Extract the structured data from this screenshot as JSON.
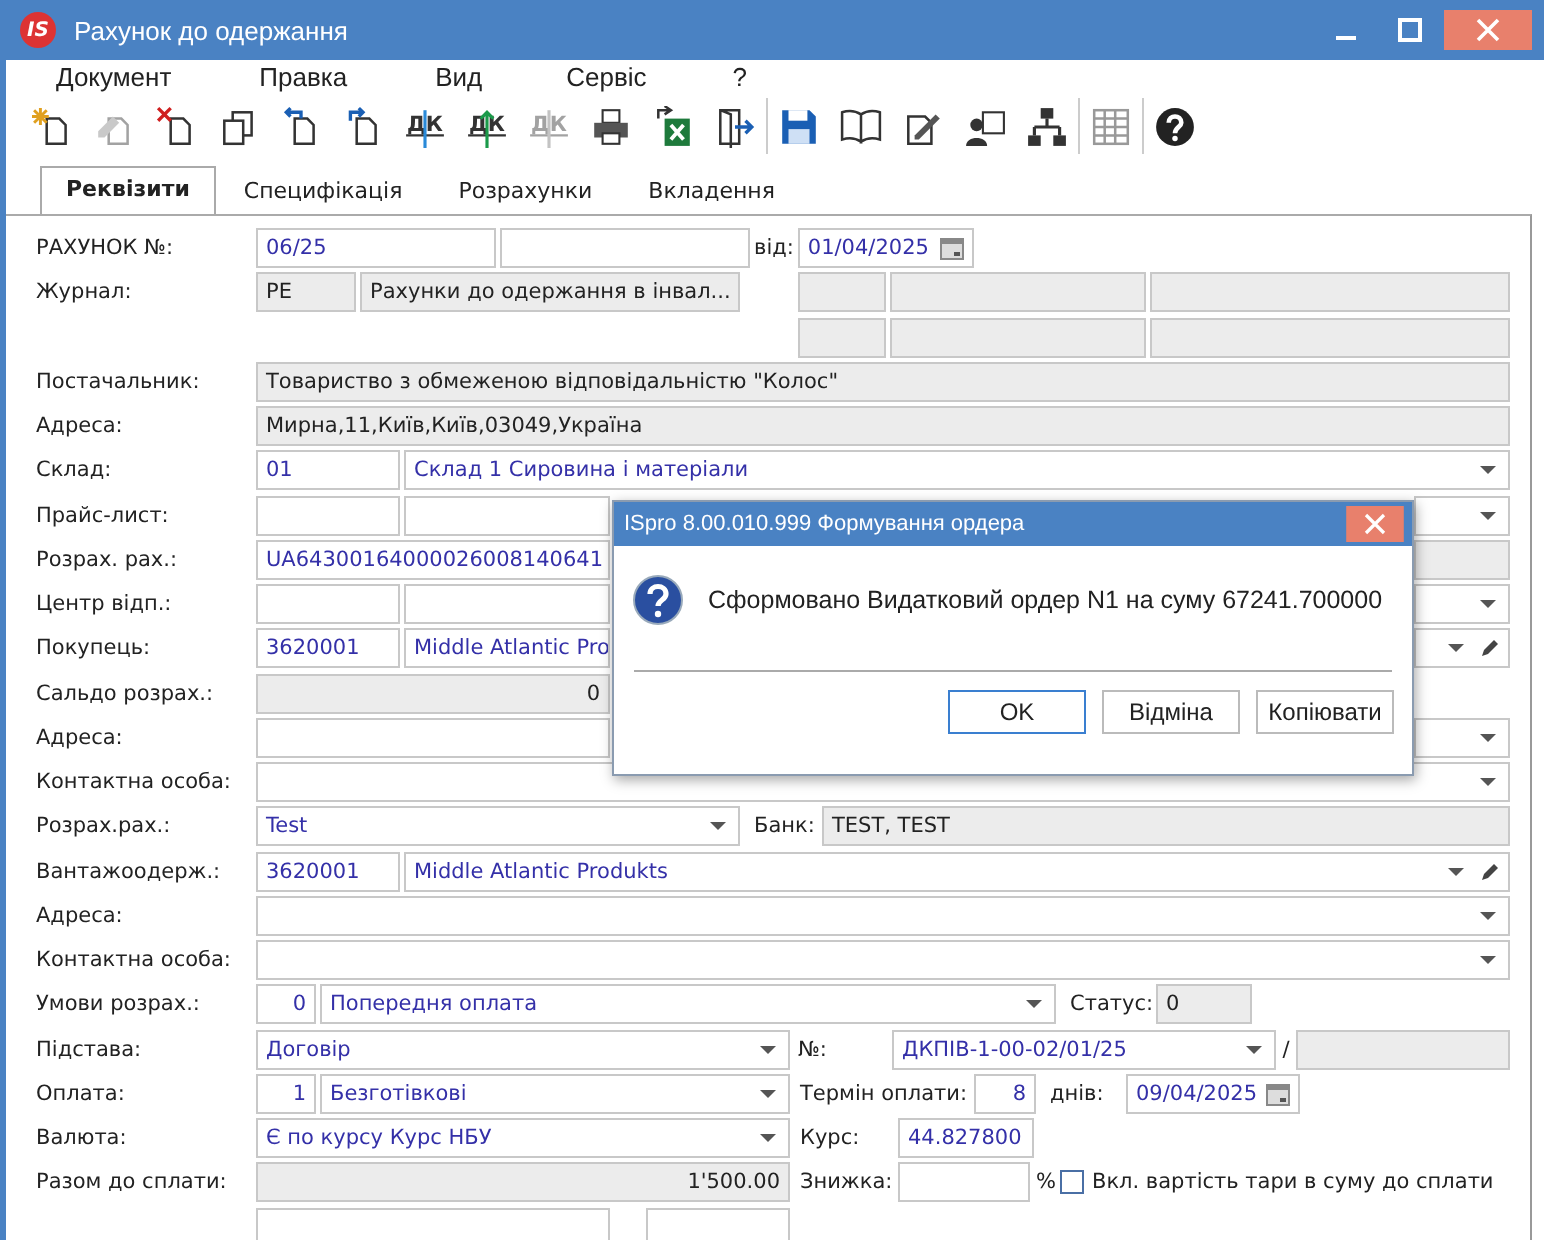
{
  "window": {
    "logo": "IS",
    "title": "Рахунок до одержання"
  },
  "menu": [
    "Документ",
    "Правка",
    "Вид",
    "Сервіс",
    "?"
  ],
  "toolbar": [
    [
      {
        "kind": "new",
        "disabled": false
      },
      {
        "kind": "edit",
        "disabled": true
      },
      {
        "kind": "delete",
        "disabled": false
      },
      {
        "kind": "copy",
        "disabled": false
      },
      {
        "kind": "prev",
        "disabled": false
      },
      {
        "kind": "next",
        "disabled": false
      },
      {
        "kind": "dk-down",
        "glyph": "ДК",
        "disabled": false
      },
      {
        "kind": "dk-up",
        "glyph": "ДК",
        "disabled": false
      },
      {
        "kind": "dk-down",
        "glyph": "ДК",
        "disabled": true
      },
      {
        "kind": "print",
        "disabled": false
      },
      {
        "kind": "excel",
        "disabled": false
      },
      {
        "kind": "exit",
        "disabled": false
      }
    ],
    [
      {
        "kind": "save",
        "disabled": false
      },
      {
        "kind": "book",
        "disabled": false
      },
      {
        "kind": "attach",
        "disabled": false
      },
      {
        "kind": "user",
        "disabled": false
      },
      {
        "kind": "tree",
        "disabled": false
      }
    ],
    [
      {
        "kind": "grid",
        "disabled": false
      }
    ],
    [
      {
        "kind": "help",
        "disabled": false
      }
    ]
  ],
  "tabs": [
    {
      "label": "Реквізити",
      "selected": true
    },
    {
      "label": "Специфікація",
      "selected": false
    },
    {
      "label": "Розрахунки",
      "selected": false
    },
    {
      "label": "Вкладення",
      "selected": false
    }
  ],
  "form": {
    "invoice": {
      "label": "РАХУНОК №:",
      "number": {
        "value": "06/25",
        "readonly": false
      },
      "extra": {
        "readonly": false
      },
      "date_label": "від:",
      "date": {
        "value": "01/04/2025",
        "readonly": false
      }
    },
    "journal": {
      "label": "Журнал:",
      "code": {
        "value": "РЕ",
        "readonly": true
      },
      "name": {
        "value": "Рахунки до одержання в інвал...",
        "readonly": true
      }
    },
    "side_grid": [
      [
        {
          "readonly": true
        },
        {
          "readonly": true
        },
        {
          "readonly": true
        }
      ],
      [
        {
          "readonly": true
        },
        {
          "readonly": true
        },
        {
          "readonly": true
        }
      ]
    ],
    "supplier": {
      "label": "Постачальник:",
      "field": {
        "value": "Товариство з обмеженою відповідальністю \"Колос\"",
        "readonly": true
      }
    },
    "supplier_address": {
      "label": "Адреса:",
      "field": {
        "value": "Мирна,11,Київ,Київ,03049,Україна",
        "readonly": true
      }
    },
    "warehouse": {
      "label": "Склад:",
      "code": {
        "value": "01",
        "readonly": false
      },
      "name": {
        "value": "Склад 1 Сировина і матеріали",
        "readonly": false
      }
    },
    "price_list": {
      "label": "Прайс-лист:",
      "code": {
        "readonly": false
      },
      "name": {
        "readonly": false
      }
    },
    "account": {
      "label": "Розрах. рах.:",
      "field": {
        "value": "UA64300164000026008140641",
        "readonly": false
      },
      "bank": {
        "readonly": true
      }
    },
    "center": {
      "label": "Центр відп.:",
      "code": {
        "readonly": false
      },
      "name": {
        "readonly": false
      }
    },
    "buyer": {
      "label": "Покупець:",
      "code": {
        "value": "3620001",
        "readonly": false
      },
      "name": {
        "value": "Middle Atlantic Pro",
        "readonly": false
      }
    },
    "balance": {
      "label": "Сальдо розрах.:",
      "field": {
        "value": "0",
        "readonly": true
      }
    },
    "buyer_address": {
      "label": "Адреса:",
      "field": {
        "readonly": false
      }
    },
    "buyer_contact": {
      "label": "Контактна особа:",
      "field": {
        "readonly": false
      }
    },
    "settlement": {
      "label": "Розрах.рах.:",
      "field": {
        "value": "Test",
        "readonly": false
      },
      "bank_label": "Банк:",
      "bank": {
        "value": "TEST, TEST",
        "readonly": true
      }
    },
    "consignee": {
      "label": "Вантажоодерж.:",
      "code": {
        "value": "3620001",
        "readonly": false
      },
      "name": {
        "value": "Middle Atlantic Produkts",
        "readonly": false
      }
    },
    "consignee_address": {
      "label": "Адреса:",
      "field": {
        "readonly": false
      }
    },
    "consignee_contact": {
      "label": "Контактна особа:",
      "field": {
        "readonly": false
      }
    },
    "terms": {
      "label": "Умови розрах.:",
      "code": {
        "value": "0",
        "readonly": false
      },
      "name": {
        "value": "Попередня оплата",
        "readonly": false
      },
      "status_label": "Статус:",
      "status": {
        "value": "0",
        "readonly": true
      }
    },
    "basis": {
      "label": "Підстава:",
      "field": {
        "value": "Договір",
        "readonly": false
      },
      "number_label": "№:",
      "number": {
        "value": "ДКПІВ-1-00-02/01/25",
        "readonly": false
      },
      "separator": "/",
      "suffix": {
        "readonly": true
      }
    },
    "payment": {
      "label": "Оплата:",
      "code": {
        "value": "1",
        "readonly": false
      },
      "name": {
        "value": "Безготівкові",
        "readonly": false
      },
      "term_label": "Термін оплати:",
      "term": {
        "value": "8",
        "readonly": false
      },
      "days_label": "днів:",
      "due_date": {
        "value": "09/04/2025",
        "readonly": false
      }
    },
    "currency": {
      "label": "Валюта:",
      "field": {
        "value": "Є по курсу Курс НБУ",
        "readonly": false
      },
      "rate_label": "Курс:",
      "rate": {
        "value": "44.827800",
        "readonly": false
      }
    },
    "total": {
      "label": "Разом до сплати:",
      "field": {
        "value": "1'500.00",
        "readonly": true
      },
      "discount_label": "Знижка:",
      "discount": {
        "readonly": false
      },
      "percent": "%",
      "tare": {
        "label": "Вкл. вартість тари в суму до сплати",
        "checked": false
      }
    },
    "advance": {
      "field": {
        "readonly": false
      },
      "extra": {
        "readonly": false
      }
    }
  },
  "dialog": {
    "title": "ISpro 8.00.010.999 Формування ордера",
    "message": "Сформовано Видатковий ордер N1 на суму 67241.700000",
    "buttons": [
      {
        "label": "OK",
        "default": true
      },
      {
        "label": "Відміна",
        "default": false
      },
      {
        "label": "Копіювати",
        "default": false
      }
    ]
  }
}
